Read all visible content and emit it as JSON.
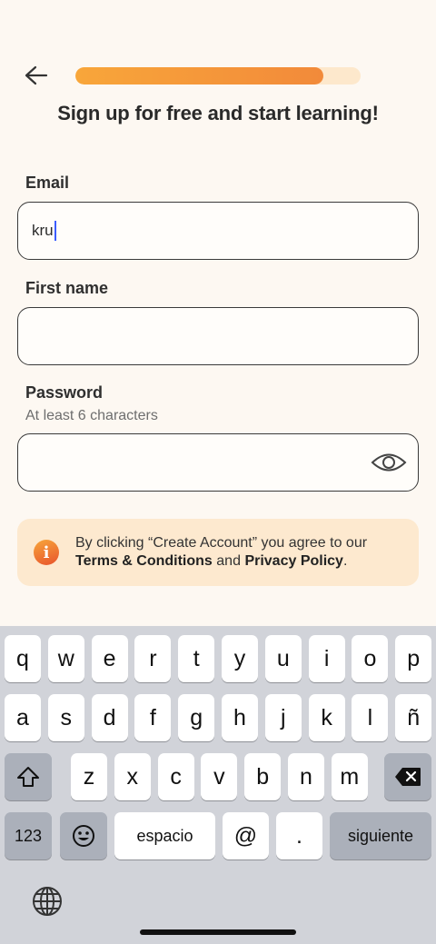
{
  "header": {
    "progress_fraction": 0.87,
    "back_icon": "arrow-left-icon"
  },
  "title": "Sign up for free and start learning!",
  "email": {
    "label": "Email",
    "value": "kru"
  },
  "first_name": {
    "label": "First name",
    "value": ""
  },
  "password": {
    "label": "Password",
    "hint": "At least 6 characters",
    "value": "",
    "toggle_icon": "eye-icon"
  },
  "notice": {
    "icon": "info-icon",
    "text_prefix": "By clicking “Create Account” you agree to our",
    "terms": "Terms & Conditions",
    "and": "and",
    "privacy": "Privacy Policy",
    "suffix": "."
  },
  "keyboard": {
    "row1": [
      "q",
      "w",
      "e",
      "r",
      "t",
      "y",
      "u",
      "i",
      "o",
      "p"
    ],
    "row2": [
      "a",
      "s",
      "d",
      "f",
      "g",
      "h",
      "j",
      "k",
      "l",
      "ñ"
    ],
    "row3": [
      "z",
      "x",
      "c",
      "v",
      "b",
      "n",
      "m"
    ],
    "numbers_key": "123",
    "space_key": "espacio",
    "at_key": "@",
    "dot_key": ".",
    "return_key": "siguiente"
  },
  "colors": {
    "accent": "#f28a3a",
    "track": "#fde8cc",
    "notice_bg": "#fde9cf",
    "background": "#fdf8f2"
  }
}
